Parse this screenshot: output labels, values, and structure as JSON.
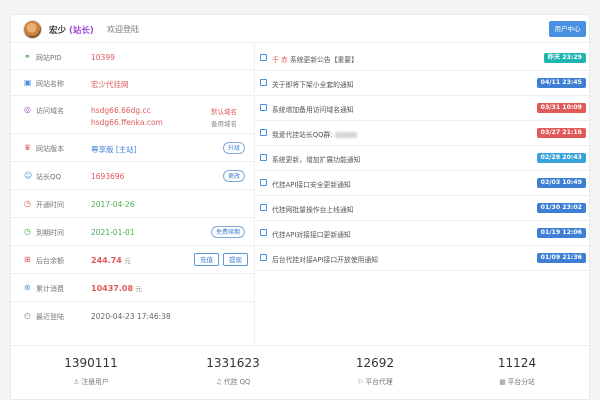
{
  "header": {
    "username": "宏少",
    "role": "(站长)",
    "welcome": "欢迎登陆",
    "user_center_label": "用户中心"
  },
  "info": {
    "site_pid": {
      "label": "网站PID",
      "value": "10399"
    },
    "site_name": {
      "label": "网站名称",
      "value": "宏少代挂网"
    },
    "domain": {
      "label": "访问域名",
      "value1": "hsdg66.66dg.cc",
      "tag1": "默认域名",
      "value2": "hsdg66.ffenka.com",
      "tag2": "备用域名"
    },
    "version": {
      "label": "网站版本",
      "value": "尊享版 [主站]",
      "btn": "升级"
    },
    "qq": {
      "label": "站长QQ",
      "value": "1693696",
      "btn": "更改"
    },
    "open_time": {
      "label": "开通时间",
      "value": "2017-04-26"
    },
    "expire_time": {
      "label": "到期时间",
      "value": "2021-01-01",
      "btn": "免费续期"
    },
    "balance": {
      "label": "后台余额",
      "value": "244.74",
      "unit": "元",
      "btn1": "充值",
      "btn2": "提现"
    },
    "spent": {
      "label": "累计消费",
      "value": "10437.08",
      "unit": "元"
    },
    "last_login": {
      "label": "最近登陆",
      "value": "2020-04-23 17:46:38"
    }
  },
  "notices": [
    {
      "hot": "千 赤",
      "title": "系统更新公告【重要】",
      "date": "昨天 23:29",
      "color": "#1cb5b0"
    },
    {
      "hot": "",
      "title": "关于即将下架小全套的通知",
      "date": "04/11 23:45",
      "color": "#3f7fd3"
    },
    {
      "hot": "",
      "title": "系统增加备用访问域名通知",
      "date": "03/31 10:09",
      "color": "#e05a5a"
    },
    {
      "hot": "",
      "title": "我爱代挂站长QQ群:",
      "date": "03/27 21:16",
      "color": "#e05a5a"
    },
    {
      "hot": "",
      "title": "系统更新，增加扩展功能通知",
      "date": "02/28 20:43",
      "color": "#3aa3d9"
    },
    {
      "hot": "",
      "title": "代挂API接口安全更新通知",
      "date": "02/03 10:49",
      "color": "#3f7fd3"
    },
    {
      "hot": "",
      "title": "代挂网批量操作台上线通知",
      "date": "01/30 23:02",
      "color": "#3f7fd3"
    },
    {
      "hot": "",
      "title": "代挂API对接接口更新通知",
      "date": "01/19 12:06",
      "color": "#3f7fd3"
    },
    {
      "hot": "",
      "title": "后台代挂对接API接口开放使用通知",
      "date": "01/09 21:36",
      "color": "#3f7fd3"
    }
  ],
  "stats": [
    {
      "num": "1390111",
      "label": "注册用户",
      "icon": "user-icon"
    },
    {
      "num": "1331623",
      "label": "代挂 QQ",
      "icon": "bell-icon"
    },
    {
      "num": "12692",
      "label": "平台代理",
      "icon": "agent-icon"
    },
    {
      "num": "11124",
      "label": "平台分站",
      "icon": "site-icon"
    }
  ]
}
